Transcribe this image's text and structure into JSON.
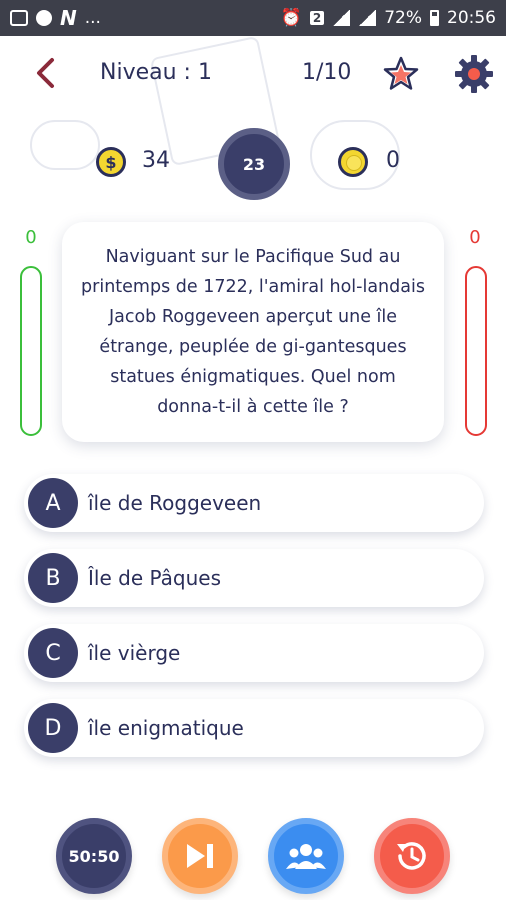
{
  "status_bar": {
    "battery": "72%",
    "time": "20:56",
    "notif_badge": "2",
    "dots": "..."
  },
  "header": {
    "level": "Niveau : 1",
    "progress": "1/10"
  },
  "stats": {
    "coins": "34",
    "timer": "23",
    "gold": "0"
  },
  "scores": {
    "correct": "0",
    "wrong": "0"
  },
  "question": {
    "text": "Naviguant sur le Pacifique Sud au printemps de 1722, l'amiral hol-landais Jacob Roggeveen aperçut une île étrange, peuplée de gi-gantesques statues énigmatiques. Quel nom donna-t-il à cette île ?"
  },
  "answers": [
    {
      "letter": "A",
      "text": "île de Roggeveen"
    },
    {
      "letter": "B",
      "text": "Île de Pâques"
    },
    {
      "letter": "C",
      "text": "île vièrge"
    },
    {
      "letter": "D",
      "text": "île enigmatique"
    }
  ],
  "lifelines": {
    "fifty_label": "50:50"
  },
  "colors": {
    "primary": "#3a3e69",
    "accent_red": "#e53935",
    "accent_green": "#3bbf3b",
    "orange": "#fb9a4a",
    "blue": "#3b8df0",
    "coral": "#f45c4b",
    "gold": "#f3d630"
  }
}
